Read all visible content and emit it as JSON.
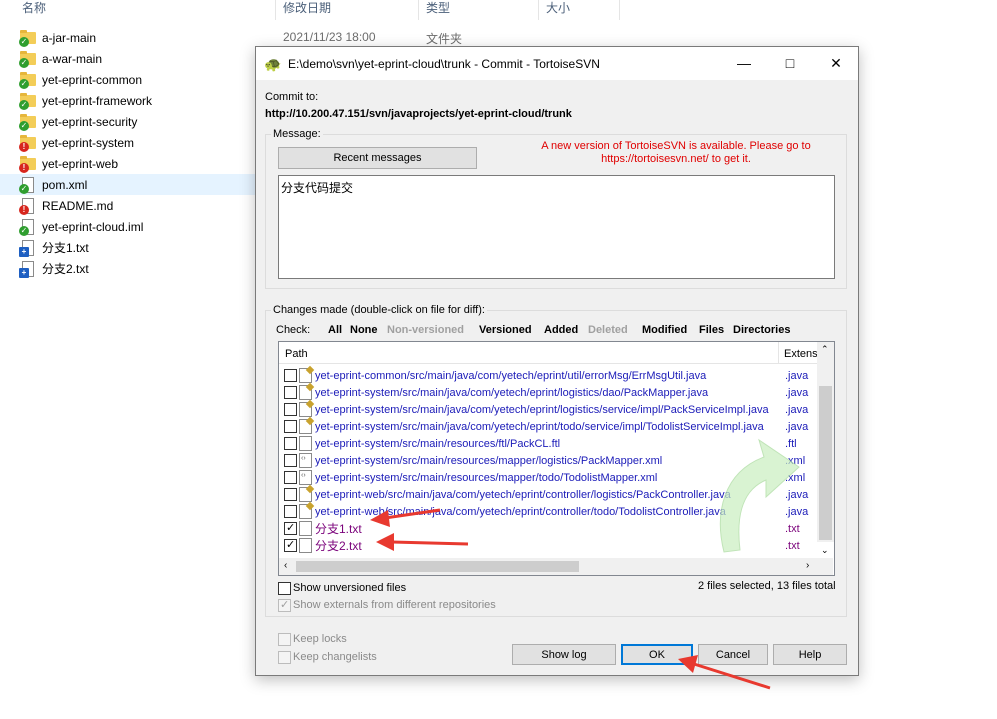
{
  "explorer": {
    "columns": [
      "名称",
      "修改日期",
      "类型",
      "大小"
    ],
    "first_row_date": "2021/11/23 18:00",
    "first_row_type": "文件夹",
    "files": [
      {
        "name": "a-jar-main",
        "icon": "folder-icon",
        "status": "ok"
      },
      {
        "name": "a-war-main",
        "icon": "folder-icon",
        "status": "ok"
      },
      {
        "name": "yet-eprint-common",
        "icon": "folder-icon",
        "status": "ok"
      },
      {
        "name": "yet-eprint-framework",
        "icon": "folder-icon",
        "status": "ok"
      },
      {
        "name": "yet-eprint-security",
        "icon": "folder-icon",
        "status": "ok"
      },
      {
        "name": "yet-eprint-system",
        "icon": "folder-icon",
        "status": "modified"
      },
      {
        "name": "yet-eprint-web",
        "icon": "folder-icon",
        "status": "modified"
      },
      {
        "name": "pom.xml",
        "icon": "file-icon",
        "status": "ok"
      },
      {
        "name": "README.md",
        "icon": "file-icon",
        "status": "modified"
      },
      {
        "name": "yet-eprint-cloud.iml",
        "icon": "file-icon",
        "status": "ok"
      },
      {
        "name": "分支1.txt",
        "icon": "file-icon",
        "status": "added"
      },
      {
        "name": "分支2.txt",
        "icon": "file-icon",
        "status": "added"
      }
    ]
  },
  "dialog": {
    "title": "E:\\demo\\svn\\yet-eprint-cloud\\trunk - Commit - TortoiseSVN",
    "commit_to_label": "Commit to:",
    "commit_url": "http://10.200.47.151/svn/javaprojects/yet-eprint-cloud/trunk",
    "message_label": "Message:",
    "recent_messages_button": "Recent messages",
    "update_notice_line1": "A new version of TortoiseSVN is available. Please go to",
    "update_notice_line2": "https://tortoisesvn.net/ to get it.",
    "message_text": "分支代码提交",
    "changes_label": "Changes made (double-click on file for diff):",
    "check_label": "Check:",
    "filters": [
      {
        "label": "All",
        "enabled": true
      },
      {
        "label": "None",
        "enabled": true
      },
      {
        "label": "Non-versioned",
        "enabled": false
      },
      {
        "label": "Versioned",
        "enabled": true
      },
      {
        "label": "Added",
        "enabled": true
      },
      {
        "label": "Deleted",
        "enabled": false
      },
      {
        "label": "Modified",
        "enabled": true
      },
      {
        "label": "Files",
        "enabled": true
      },
      {
        "label": "Directories",
        "enabled": true
      }
    ],
    "list_headers": {
      "path": "Path",
      "ext": "Extens"
    },
    "rows": [
      {
        "path": "yet-eprint-common/src/main/java/com/yetech/eprint/util/errorMsg/ErrMsgUtil.java",
        "ext": ".java",
        "checked": false,
        "kind": "java",
        "added": false
      },
      {
        "path": "yet-eprint-system/src/main/java/com/yetech/eprint/logistics/dao/PackMapper.java",
        "ext": ".java",
        "checked": false,
        "kind": "java",
        "added": false
      },
      {
        "path": "yet-eprint-system/src/main/java/com/yetech/eprint/logistics/service/impl/PackServiceImpl.java",
        "ext": ".java",
        "checked": false,
        "kind": "java",
        "added": false
      },
      {
        "path": "yet-eprint-system/src/main/java/com/yetech/eprint/todo/service/impl/TodolistServiceImpl.java",
        "ext": ".java",
        "checked": false,
        "kind": "java",
        "added": false
      },
      {
        "path": "yet-eprint-system/src/main/resources/ftl/PackCL.ftl",
        "ext": ".ftl",
        "checked": false,
        "kind": "file",
        "added": false
      },
      {
        "path": "yet-eprint-system/src/main/resources/mapper/logistics/PackMapper.xml",
        "ext": ".xml",
        "checked": false,
        "kind": "xml",
        "added": false
      },
      {
        "path": "yet-eprint-system/src/main/resources/mapper/todo/TodolistMapper.xml",
        "ext": ".xml",
        "checked": false,
        "kind": "xml",
        "added": false
      },
      {
        "path": "yet-eprint-web/src/main/java/com/yetech/eprint/controller/logistics/PackController.java",
        "ext": ".java",
        "checked": false,
        "kind": "java",
        "added": false
      },
      {
        "path": "yet-eprint-web/src/main/java/com/yetech/eprint/controller/todo/TodolistController.java",
        "ext": ".java",
        "checked": false,
        "kind": "java",
        "added": false
      },
      {
        "path": "分支1.txt",
        "ext": ".txt",
        "checked": true,
        "kind": "file",
        "added": true
      },
      {
        "path": "分支2.txt",
        "ext": ".txt",
        "checked": true,
        "kind": "file",
        "added": true
      }
    ],
    "show_unversioned": "Show unversioned files",
    "selection_status": "2 files selected, 13 files total",
    "show_externals": "Show externals from different repositories",
    "keep_locks": "Keep locks",
    "keep_changelists": "Keep changelists",
    "buttons": {
      "show_log": "Show log",
      "ok": "OK",
      "cancel": "Cancel",
      "help": "Help"
    },
    "accent_color": "#0078d7",
    "notice_color": "#e00000",
    "annotation_color": "#e8392f"
  }
}
